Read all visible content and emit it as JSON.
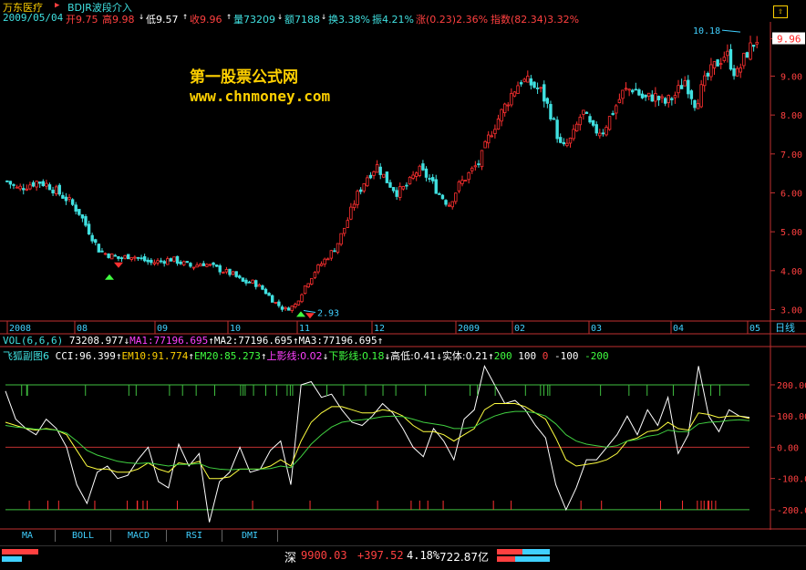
{
  "header": {
    "stock_name": "万东医疗",
    "formula_name": "BDJR波段介入",
    "date": "2009/05/04",
    "open_label": "开9.75",
    "high_label": "高9.98",
    "low_label": "低9.57",
    "close_label": "收9.96",
    "vol_label": "量73209",
    "amount_label": "额7188",
    "turnover_label": "换3.38%",
    "amplitude_label": "振4.21%",
    "change_label": "涨(0.23)2.36%",
    "index_label": "指数(82.34)3.32%"
  },
  "watermark": {
    "line1": "第一股票公式网",
    "line2": "www.chnmoney.com"
  },
  "vol_line": {
    "title": "VOL(6,6,6)",
    "vol": "73208.977",
    "ma1": "MA1:77196.695",
    "ma2": "MA2:77196.695",
    "ma3": "MA3:77196.695"
  },
  "indicator_line": {
    "title": "飞狐副图6",
    "cci": "CCI:96.399",
    "em10": "EM10:91.774",
    "em20": "EM20:85.273",
    "upper_shadow": "上影线:0.02",
    "lower_shadow": "下影线:0.18",
    "high_low": "高低:0.41",
    "body": "实体:0.21",
    "c200": "200",
    "c100": "100",
    "c0": "0",
    "cm100": "-100",
    "cm200": "-200"
  },
  "tabs": [
    "MA",
    "BOLL",
    "MACD",
    "RSI",
    "DMI"
  ],
  "status": {
    "market": "深",
    "index": "9900.03",
    "change": "+397.52",
    "pct": "4.18%",
    "amount": "722.87亿"
  },
  "colors": {
    "up": "#ff3030",
    "down": "#40e0e0",
    "cci": "#ffffff",
    "em10": "#ffff40",
    "em20": "#40d040",
    "axis": "#c03030"
  },
  "chart_data": [
    {
      "type": "candlestick",
      "yaxis_ticks": [
        3.0,
        4.0,
        5.0,
        6.0,
        7.0,
        8.0,
        9.0,
        9.96
      ],
      "ylim": [
        2.8,
        10.3
      ],
      "current_price": "9.96",
      "annotation_high": "10.18",
      "annotation_low": "2.93",
      "x_ticks": [
        "2008",
        "08",
        "09",
        "10",
        "11",
        "12",
        "2009",
        "02",
        "03",
        "04",
        "05"
      ],
      "period_label": "日线",
      "close_path": [
        6.3,
        6.1,
        6.2,
        6.3,
        6.2,
        6.0,
        5.8,
        5.5,
        5.0,
        4.5,
        4.4,
        4.3,
        4.4,
        4.3,
        4.2,
        4.25,
        4.3,
        4.2,
        4.1,
        4.2,
        4.1,
        4.0,
        3.9,
        3.7,
        3.7,
        3.5,
        3.2,
        3.0,
        3.1,
        3.6,
        4.0,
        4.3,
        4.6,
        5.2,
        5.9,
        6.4,
        6.7,
        6.3,
        6.0,
        6.2,
        6.6,
        6.4,
        6.0,
        5.7,
        6.2,
        6.5,
        6.8,
        7.5,
        8.0,
        8.5,
        8.9,
        8.8,
        8.6,
        8.0,
        7.1,
        7.4,
        8.1,
        7.6,
        7.6,
        8.1,
        8.6,
        8.7,
        8.4,
        8.5,
        8.3,
        8.5,
        8.9,
        8.3,
        8.9,
        9.3,
        9.6,
        9.0,
        9.6,
        9.96
      ],
      "buy_signals": [
        4.0,
        3.05
      ],
      "sell_signals": [
        4.4,
        3.1
      ]
    },
    {
      "type": "line",
      "yaxis_ticks": [
        200.0,
        100.0,
        0.0,
        -100.0,
        -200.0
      ],
      "ylim": [
        -250,
        270
      ],
      "series": [
        {
          "name": "CCI",
          "values": [
            180,
            90,
            60,
            40,
            90,
            60,
            0,
            -120,
            -180,
            -80,
            -60,
            -100,
            -90,
            -40,
            0,
            -110,
            -130,
            10,
            -60,
            -20,
            -240,
            -110,
            -80,
            0,
            -80,
            -70,
            -10,
            20,
            -120,
            200,
            210,
            160,
            170,
            120,
            80,
            70,
            100,
            140,
            110,
            60,
            0,
            -30,
            60,
            20,
            -40,
            90,
            120,
            260,
            200,
            140,
            150,
            120,
            70,
            30,
            -120,
            -200,
            -130,
            -40,
            -40,
            0,
            40,
            100,
            40,
            120,
            70,
            160,
            -20,
            40,
            260,
            100,
            50,
            120,
            100,
            96
          ]
        },
        {
          "name": "EM10",
          "values": [
            80,
            70,
            60,
            55,
            60,
            55,
            40,
            -10,
            -60,
            -70,
            -70,
            -80,
            -80,
            -70,
            -50,
            -70,
            -80,
            -50,
            -55,
            -45,
            -100,
            -100,
            -95,
            -70,
            -70,
            -70,
            -60,
            -40,
            -60,
            20,
            80,
            110,
            130,
            130,
            120,
            110,
            110,
            120,
            115,
            100,
            70,
            50,
            50,
            40,
            20,
            40,
            60,
            120,
            140,
            140,
            140,
            130,
            110,
            90,
            30,
            -40,
            -60,
            -55,
            -50,
            -40,
            -20,
            20,
            30,
            50,
            55,
            80,
            60,
            55,
            110,
            105,
            95,
            100,
            100,
            92
          ]
        },
        {
          "name": "EM20",
          "values": [
            70,
            65,
            62,
            58,
            58,
            55,
            45,
            20,
            -10,
            -25,
            -35,
            -45,
            -50,
            -52,
            -50,
            -55,
            -60,
            -55,
            -55,
            -52,
            -65,
            -70,
            -72,
            -70,
            -70,
            -70,
            -68,
            -60,
            -65,
            -30,
            10,
            40,
            65,
            80,
            85,
            88,
            92,
            98,
            100,
            98,
            90,
            80,
            75,
            70,
            60,
            60,
            65,
            85,
            100,
            110,
            115,
            115,
            110,
            100,
            75,
            40,
            20,
            10,
            5,
            0,
            5,
            20,
            25,
            35,
            40,
            55,
            50,
            50,
            75,
            80,
            82,
            86,
            88,
            85
          ]
        }
      ]
    }
  ]
}
